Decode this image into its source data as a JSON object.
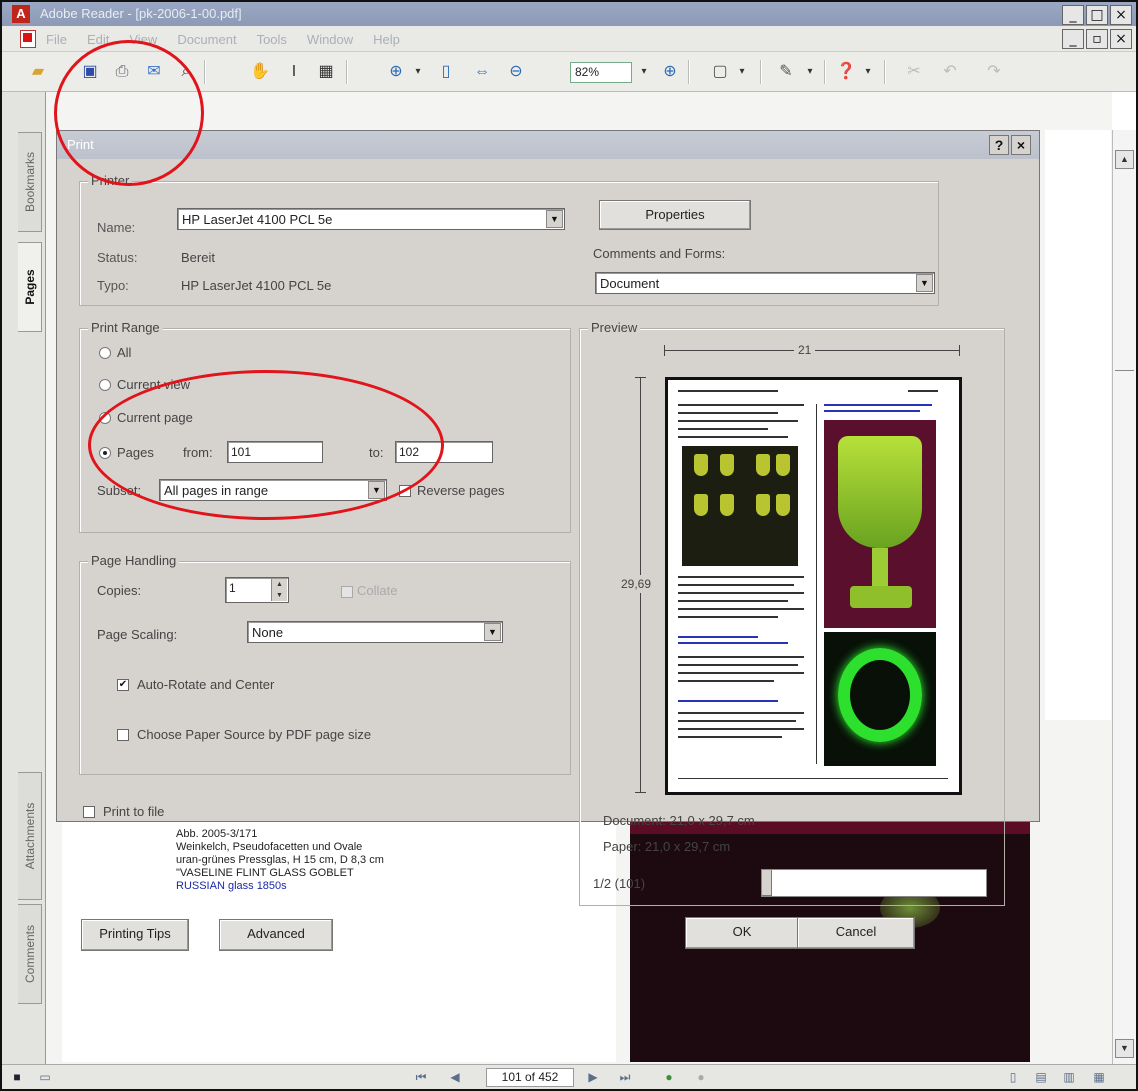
{
  "window": {
    "title": "Adobe Reader - [pk-2006-1-00.pdf]",
    "menus": [
      "File",
      "Edit",
      "View",
      "Document",
      "Tools",
      "Window",
      "Help"
    ],
    "zoom": "82%",
    "min_label": "_",
    "max_label": "□",
    "close_label": "×",
    "restore_label": "▫"
  },
  "nav_tabs": [
    "Bookmarks",
    "Pages",
    "Attachments",
    "Comments"
  ],
  "dialog": {
    "title": "Print",
    "help_label": "?",
    "close_label": "×",
    "printer": {
      "legend": "Printer",
      "name_label": "Name:",
      "name_value": "HP LaserJet 4100 PCL 5e",
      "status_label": "Status:",
      "status_value": "Bereit",
      "type_label": "Typo:",
      "type_value": "HP LaserJet 4100 PCL 5e",
      "properties_button": "Properties",
      "comments_label": "Comments and Forms:",
      "comments_value": "Document"
    },
    "print_range": {
      "legend": "Print Range",
      "all": "All",
      "current_view": "Current view",
      "current_page": "Current page",
      "pages": "Pages",
      "from_label": "from:",
      "from_value": "101",
      "to_label": "to:",
      "to_value": "102",
      "subset_label": "Subset:",
      "subset_value": "All pages in range",
      "reverse_label": "Reverse pages"
    },
    "page_handling": {
      "legend": "Page Handling",
      "copies_label": "Copies:",
      "copies_value": "1",
      "collate_label": "Collate",
      "scaling_label": "Page Scaling:",
      "scaling_value": "None",
      "auto_rotate_label": "Auto-Rotate and Center",
      "paper_source_label": "Choose Paper Source by PDF page size"
    },
    "print_to_file": "Print to file",
    "preview": {
      "legend": "Preview",
      "width_label": "21",
      "height_label": "29,69",
      "document_size": "Document: 21,0 x 29,7 cm",
      "paper_size": "Paper: 21,0 x 29,7 cm",
      "page_indicator": "1/2 (101)"
    },
    "printing_tips_button": "Printing Tips",
    "advanced_button": "Advanced",
    "ok_button": "OK",
    "cancel_button": "Cancel"
  },
  "document": {
    "caption_lines": [
      "Abb. 2005-3/171",
      "Weinkelch, Pseudofacetten und Ovale",
      "uran-grünes Pressglas, H 15 cm, D 8,3 cm",
      "\"VASELINE FLINT GLASS GOBLET",
      "RUSSIAN glass 1850s"
    ]
  },
  "statusbar": {
    "page_box": "101 of 452"
  },
  "colors": {
    "annotation_circle": "#e0141a",
    "dialog_face": "#d6d3ce",
    "link_blue": "#2733b8"
  }
}
